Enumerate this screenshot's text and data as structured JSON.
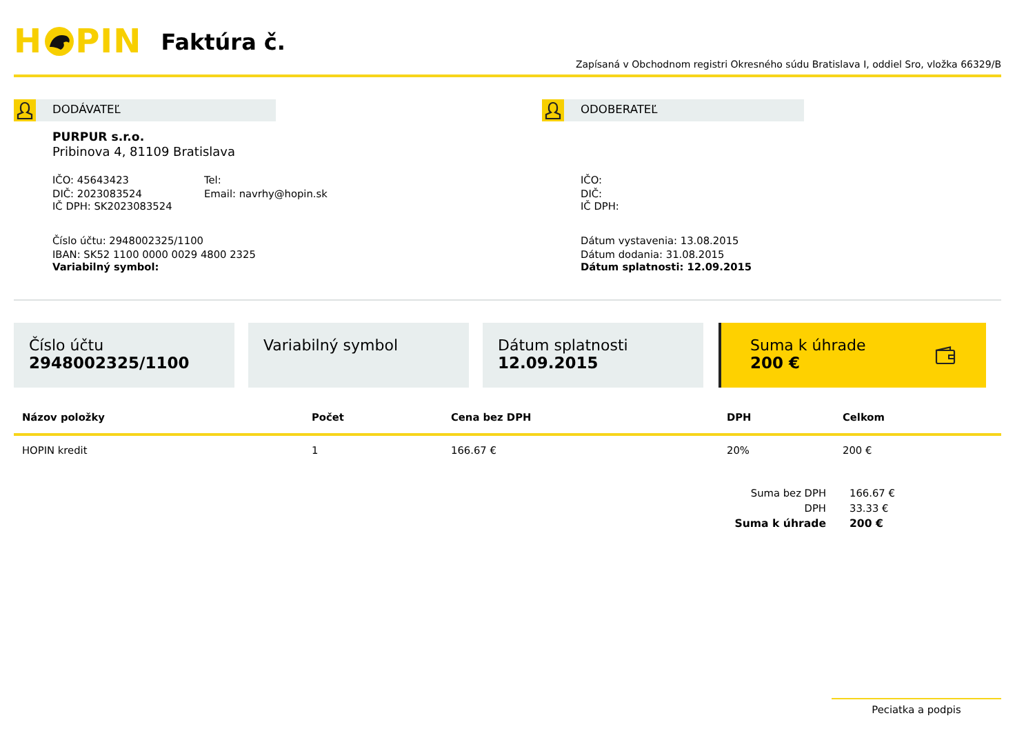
{
  "header": {
    "logo_parts": [
      "H",
      "PIN"
    ],
    "title": "Faktúra č.",
    "registry": "Zapísaná v Obchodnom registri Okresného súdu Bratislava I, oddiel Sro, vložka 66329/B"
  },
  "parties": [
    {
      "heading": "DODÁVATEĽ",
      "name": "PURPUR s.r.o.",
      "address": "Pribinova 4, 81109 Bratislava",
      "ids": [
        "IČO: 45643423",
        "DIČ: 2023083524",
        "IČ DPH: SK2023083524"
      ],
      "contact": [
        "Tel:",
        "Email: navrhy@hopin.sk"
      ],
      "details": [
        {
          "text": "Číslo účtu: 2948002325/1100",
          "kind": "normal"
        },
        {
          "text": "IBAN: SK52 1100 0000 0029 4800 2325",
          "kind": "normal"
        },
        {
          "text": "Variabilný symbol:",
          "kind": "strong"
        }
      ]
    },
    {
      "heading": "ODOBERATEĽ",
      "ids": [
        "IČO:",
        "DIČ:",
        "IČ DPH:"
      ],
      "details": [
        {
          "text": "Dátum vystavenia: 13.08.2015",
          "kind": "normal"
        },
        {
          "text": "Dátum dodania: 31.08.2015",
          "kind": "normal"
        },
        {
          "text": "Dátum splatnosti: 12.09.2015",
          "kind": "strong"
        }
      ]
    }
  ],
  "cards": [
    {
      "label": "Číslo účtu",
      "value": "2948002325/1100",
      "kind": "plain"
    },
    {
      "label": "Variabilný symbol",
      "kind": "plain"
    },
    {
      "label": "Dátum splatnosti",
      "value": "12.09.2015",
      "kind": "plain"
    },
    {
      "label": "Suma k úhrade",
      "value": "200 €",
      "kind": "highlight"
    }
  ],
  "table": {
    "columns": [
      "Názov položky",
      "Počet",
      "Cena bez DPH",
      "DPH",
      "Celkom"
    ],
    "rows": [
      [
        "HOPIN kredit",
        "1",
        "166.67 €",
        "20%",
        "200 €"
      ]
    ]
  },
  "totals": [
    {
      "label": "Suma bez DPH",
      "value": "166.67 €",
      "kind": "normal"
    },
    {
      "label": "DPH",
      "value": "33.33 €",
      "kind": "normal"
    },
    {
      "label": "Suma k úhrade",
      "value": "200 €",
      "kind": "strong"
    }
  ],
  "signature": {
    "label": "Peciatka a podpis"
  }
}
